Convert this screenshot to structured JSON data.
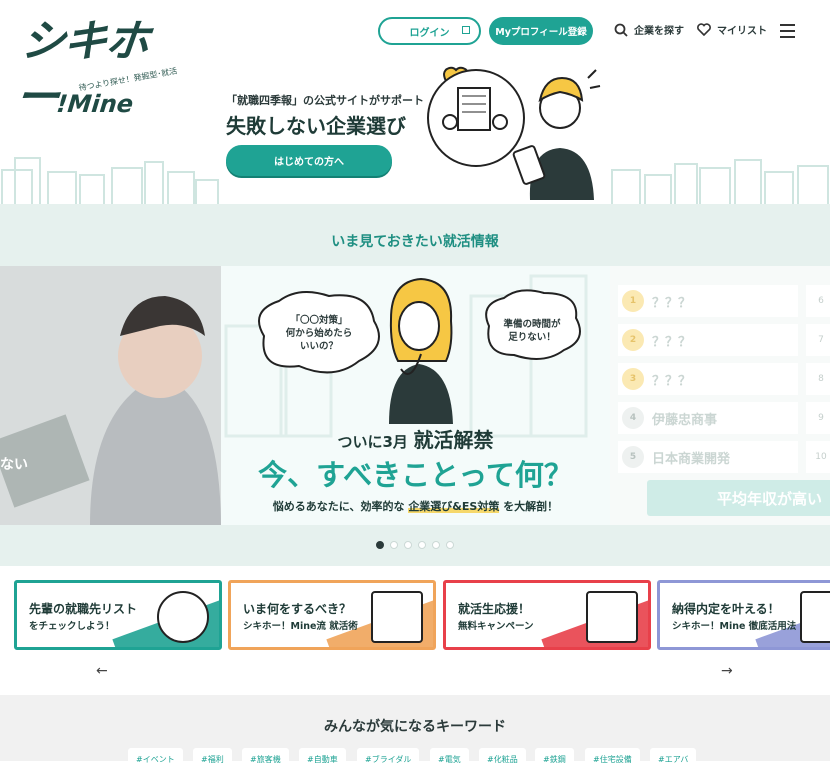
{
  "header": {
    "logo": "シキホー！Mine",
    "logo_tagline": "待つより探せ！発掘型･就活",
    "login_label": "ログイン",
    "register_label": "Myプロフィール登録",
    "search_label": "企業を探す",
    "mylist_label": "マイリスト"
  },
  "hero": {
    "subtitle": "「就職四季報」の公式サイトがサポート",
    "title": "失敗しない企業選び",
    "cta_label": "はじめての方へ"
  },
  "info_section": {
    "title": "いま見ておきたい就活情報",
    "left_slide_text": "ない",
    "main_slide": {
      "bubble_left": "「〇〇対策」\n何から始めたら\nいいの？",
      "bubble_right": "準備の時間が\n足りない！",
      "line1_small": "ついに3月",
      "line1_big": "就活解禁",
      "headline": "今、すべきことって何？",
      "caption_pre": "悩めるあなたに、効率的な",
      "caption_highlight": "企業選び&ES対策",
      "caption_post": "を大解剖！"
    },
    "ranking": {
      "items": [
        {
          "rank": "1",
          "name": "？？？"
        },
        {
          "rank": "2",
          "name": "？？？"
        },
        {
          "rank": "3",
          "name": "？？？"
        },
        {
          "rank": "4",
          "name": "伊藤忠商事"
        },
        {
          "rank": "5",
          "name": "日本商業開発"
        }
      ],
      "side_ranks": [
        "6",
        "7",
        "8",
        "9",
        "10"
      ],
      "cta": "平均年収が高い"
    },
    "dots_count": 6,
    "active_dot": 0
  },
  "banners": [
    {
      "line1": "先輩の就職先リスト",
      "line2": "をチェックしよう！",
      "color": "#1fa394"
    },
    {
      "line1": "いま何をするべき？",
      "line2": "シキホー！Mine流 就活術",
      "color": "#f0a45a"
    },
    {
      "line1": "就活生応援！",
      "line2": "無料キャンペーン",
      "color": "#e8404a"
    },
    {
      "line1": "納得内定を叶える！",
      "line2": "シキホー！Mine 徹底活用法",
      "color": "#8e97d6"
    }
  ],
  "keywords": {
    "title": "みんなが気になるキーワード",
    "items": [
      "#イベント",
      "#福利",
      "#旅客機",
      "#自動車",
      "#ブライダル",
      "#電気",
      "#化粧品",
      "#鉄鋼",
      "#住宅設備",
      "#エアバ"
    ]
  },
  "colors": {
    "accent": "#1fa394",
    "band": "#e6f1ee"
  }
}
